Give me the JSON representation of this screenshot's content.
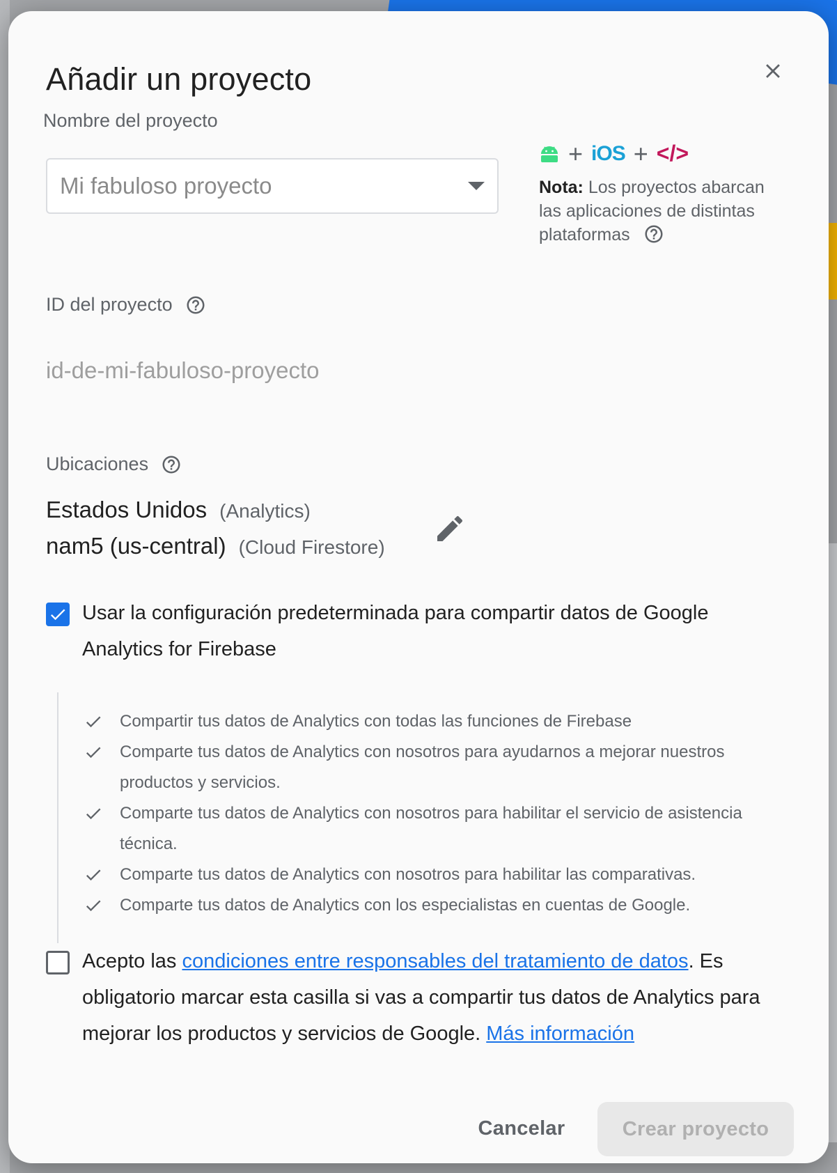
{
  "dialog": {
    "title": "Añadir un proyecto"
  },
  "project_name": {
    "label": "Nombre del proyecto",
    "placeholder": "Mi fabuloso proyecto",
    "value": ""
  },
  "platforms": {
    "plus": "+",
    "ios": "iOS",
    "web": "</>",
    "note_bold": "Nota:",
    "note_text": " Los proyectos abarcan las aplicaciones de distintas plataformas"
  },
  "project_id": {
    "label": "ID del proyecto",
    "value": "id-de-mi-fabuloso-proyecto"
  },
  "locations": {
    "label": "Ubicaciones",
    "analytics_location": "Estados Unidos",
    "analytics_tag": "(Analytics)",
    "firestore_location": "nam5 (us-central)",
    "firestore_tag": "(Cloud Firestore)"
  },
  "default_sharing": {
    "checked": true,
    "label": "Usar la configuración predeterminada para compartir datos de Google Analytics for Firebase",
    "items": [
      "Compartir tus datos de Analytics con todas las funciones de Firebase",
      "Comparte tus datos de Analytics con nosotros para ayudarnos a mejorar nuestros productos y servicios.",
      "Comparte tus datos de Analytics con nosotros para habilitar el servicio de asistencia técnica.",
      "Comparte tus datos de Analytics con nosotros para habilitar las comparativas.",
      "Comparte tus datos de Analytics con los especialistas en cuentas de Google."
    ]
  },
  "terms": {
    "checked": false,
    "prefix": "Acepto las ",
    "link_text": "condiciones entre responsables del tratamiento de datos",
    "middle": ". Es obligatorio marcar esta casilla si vas a compartir tus datos de Analytics para mejorar los productos y servicios de Google. ",
    "more_link": "Más información"
  },
  "actions": {
    "cancel_label": "Cancelar",
    "create_label": "Crear proyecto"
  },
  "colors": {
    "accent": "#1a73e8",
    "android": "#3ddc84",
    "ios": "#1ba1d6",
    "web": "#c2185b"
  }
}
